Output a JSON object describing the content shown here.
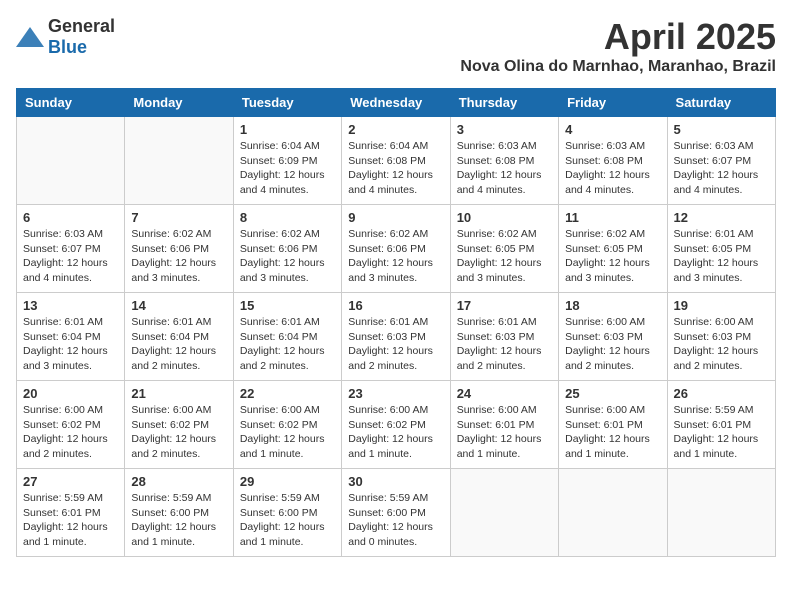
{
  "logo": {
    "general": "General",
    "blue": "Blue"
  },
  "title": "April 2025",
  "subtitle": "Nova Olina do Marnhao, Maranhao, Brazil",
  "headers": [
    "Sunday",
    "Monday",
    "Tuesday",
    "Wednesday",
    "Thursday",
    "Friday",
    "Saturday"
  ],
  "weeks": [
    [
      {
        "day": "",
        "detail": ""
      },
      {
        "day": "",
        "detail": ""
      },
      {
        "day": "1",
        "detail": "Sunrise: 6:04 AM\nSunset: 6:09 PM\nDaylight: 12 hours and 4 minutes."
      },
      {
        "day": "2",
        "detail": "Sunrise: 6:04 AM\nSunset: 6:08 PM\nDaylight: 12 hours and 4 minutes."
      },
      {
        "day": "3",
        "detail": "Sunrise: 6:03 AM\nSunset: 6:08 PM\nDaylight: 12 hours and 4 minutes."
      },
      {
        "day": "4",
        "detail": "Sunrise: 6:03 AM\nSunset: 6:08 PM\nDaylight: 12 hours and 4 minutes."
      },
      {
        "day": "5",
        "detail": "Sunrise: 6:03 AM\nSunset: 6:07 PM\nDaylight: 12 hours and 4 minutes."
      }
    ],
    [
      {
        "day": "6",
        "detail": "Sunrise: 6:03 AM\nSunset: 6:07 PM\nDaylight: 12 hours and 4 minutes."
      },
      {
        "day": "7",
        "detail": "Sunrise: 6:02 AM\nSunset: 6:06 PM\nDaylight: 12 hours and 3 minutes."
      },
      {
        "day": "8",
        "detail": "Sunrise: 6:02 AM\nSunset: 6:06 PM\nDaylight: 12 hours and 3 minutes."
      },
      {
        "day": "9",
        "detail": "Sunrise: 6:02 AM\nSunset: 6:06 PM\nDaylight: 12 hours and 3 minutes."
      },
      {
        "day": "10",
        "detail": "Sunrise: 6:02 AM\nSunset: 6:05 PM\nDaylight: 12 hours and 3 minutes."
      },
      {
        "day": "11",
        "detail": "Sunrise: 6:02 AM\nSunset: 6:05 PM\nDaylight: 12 hours and 3 minutes."
      },
      {
        "day": "12",
        "detail": "Sunrise: 6:01 AM\nSunset: 6:05 PM\nDaylight: 12 hours and 3 minutes."
      }
    ],
    [
      {
        "day": "13",
        "detail": "Sunrise: 6:01 AM\nSunset: 6:04 PM\nDaylight: 12 hours and 3 minutes."
      },
      {
        "day": "14",
        "detail": "Sunrise: 6:01 AM\nSunset: 6:04 PM\nDaylight: 12 hours and 2 minutes."
      },
      {
        "day": "15",
        "detail": "Sunrise: 6:01 AM\nSunset: 6:04 PM\nDaylight: 12 hours and 2 minutes."
      },
      {
        "day": "16",
        "detail": "Sunrise: 6:01 AM\nSunset: 6:03 PM\nDaylight: 12 hours and 2 minutes."
      },
      {
        "day": "17",
        "detail": "Sunrise: 6:01 AM\nSunset: 6:03 PM\nDaylight: 12 hours and 2 minutes."
      },
      {
        "day": "18",
        "detail": "Sunrise: 6:00 AM\nSunset: 6:03 PM\nDaylight: 12 hours and 2 minutes."
      },
      {
        "day": "19",
        "detail": "Sunrise: 6:00 AM\nSunset: 6:03 PM\nDaylight: 12 hours and 2 minutes."
      }
    ],
    [
      {
        "day": "20",
        "detail": "Sunrise: 6:00 AM\nSunset: 6:02 PM\nDaylight: 12 hours and 2 minutes."
      },
      {
        "day": "21",
        "detail": "Sunrise: 6:00 AM\nSunset: 6:02 PM\nDaylight: 12 hours and 2 minutes."
      },
      {
        "day": "22",
        "detail": "Sunrise: 6:00 AM\nSunset: 6:02 PM\nDaylight: 12 hours and 1 minute."
      },
      {
        "day": "23",
        "detail": "Sunrise: 6:00 AM\nSunset: 6:02 PM\nDaylight: 12 hours and 1 minute."
      },
      {
        "day": "24",
        "detail": "Sunrise: 6:00 AM\nSunset: 6:01 PM\nDaylight: 12 hours and 1 minute."
      },
      {
        "day": "25",
        "detail": "Sunrise: 6:00 AM\nSunset: 6:01 PM\nDaylight: 12 hours and 1 minute."
      },
      {
        "day": "26",
        "detail": "Sunrise: 5:59 AM\nSunset: 6:01 PM\nDaylight: 12 hours and 1 minute."
      }
    ],
    [
      {
        "day": "27",
        "detail": "Sunrise: 5:59 AM\nSunset: 6:01 PM\nDaylight: 12 hours and 1 minute."
      },
      {
        "day": "28",
        "detail": "Sunrise: 5:59 AM\nSunset: 6:00 PM\nDaylight: 12 hours and 1 minute."
      },
      {
        "day": "29",
        "detail": "Sunrise: 5:59 AM\nSunset: 6:00 PM\nDaylight: 12 hours and 1 minute."
      },
      {
        "day": "30",
        "detail": "Sunrise: 5:59 AM\nSunset: 6:00 PM\nDaylight: 12 hours and 0 minutes."
      },
      {
        "day": "",
        "detail": ""
      },
      {
        "day": "",
        "detail": ""
      },
      {
        "day": "",
        "detail": ""
      }
    ]
  ]
}
